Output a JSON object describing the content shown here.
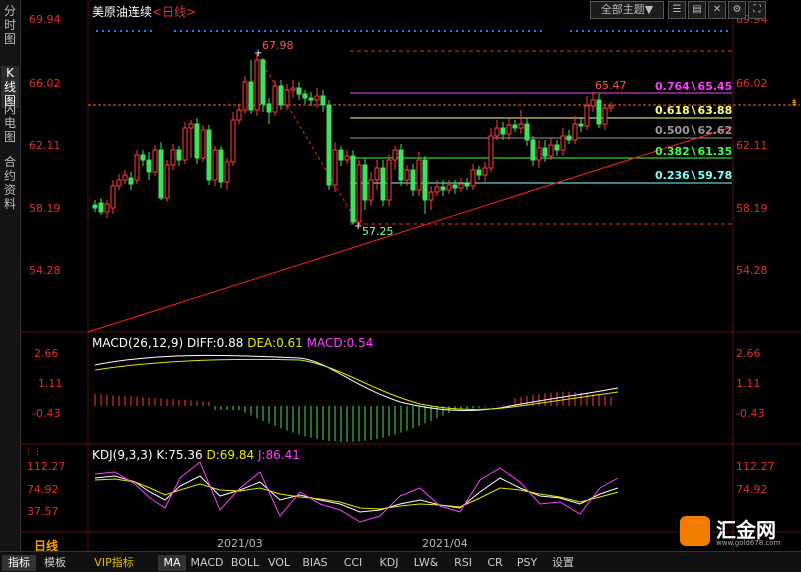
{
  "sidebar": {
    "items": [
      {
        "label": "分时图"
      },
      {
        "label": "K线图"
      },
      {
        "label": "闪电图"
      },
      {
        "label": "合约资料"
      }
    ]
  },
  "header": {
    "title": "美原油连续",
    "period": "<日线>",
    "theme_select": "全部主题▼"
  },
  "price_axis": {
    "ticks": [
      "69.94",
      "66.02",
      "62.11",
      "58.19",
      "54.28"
    ]
  },
  "annotations": {
    "high": "67.98",
    "low": "57.25",
    "fib_top": "65.47"
  },
  "fibonacci": [
    {
      "label": "0.764∖65.45",
      "color": "#ff40ff"
    },
    {
      "label": "0.618∖63.88",
      "color": "#ffff80"
    },
    {
      "label": "0.500∖62.62",
      "color": "#999999"
    },
    {
      "label": "0.382∖61.35",
      "color": "#40ff40"
    },
    {
      "label": "0.236∖59.78",
      "color": "#80ffff"
    }
  ],
  "macd": {
    "name": "MACD(26,12,9)",
    "diff": "DIFF:0.88",
    "dea": "DEA:0.61",
    "macd": "MACD:0.54",
    "ticks": [
      "2.66",
      "1.11",
      "-0.43"
    ]
  },
  "kdj": {
    "name": "KDJ(9,3,3)",
    "k": "K:75.36",
    "d": "D:69.84",
    "j": "J:86.41",
    "ticks": [
      "112.27",
      "74.92",
      "37.57"
    ]
  },
  "time_axis": {
    "period_label": "日线",
    "ticks": [
      "2021/03",
      "2021/04"
    ]
  },
  "bottom_tabs": [
    "指标",
    "模板",
    "VIP指标",
    "MA",
    "MACD",
    "BOLL",
    "VOL",
    "BIAS",
    "CCI",
    "KDJ",
    "LW&",
    "RSI",
    "CR",
    "PSY",
    "设置"
  ],
  "logo": {
    "text": "汇金网",
    "url": "www.gold678.com"
  },
  "colors": {
    "up": "#ff3c3c",
    "down": "#40e060",
    "accent_red": "#ff3030"
  }
}
